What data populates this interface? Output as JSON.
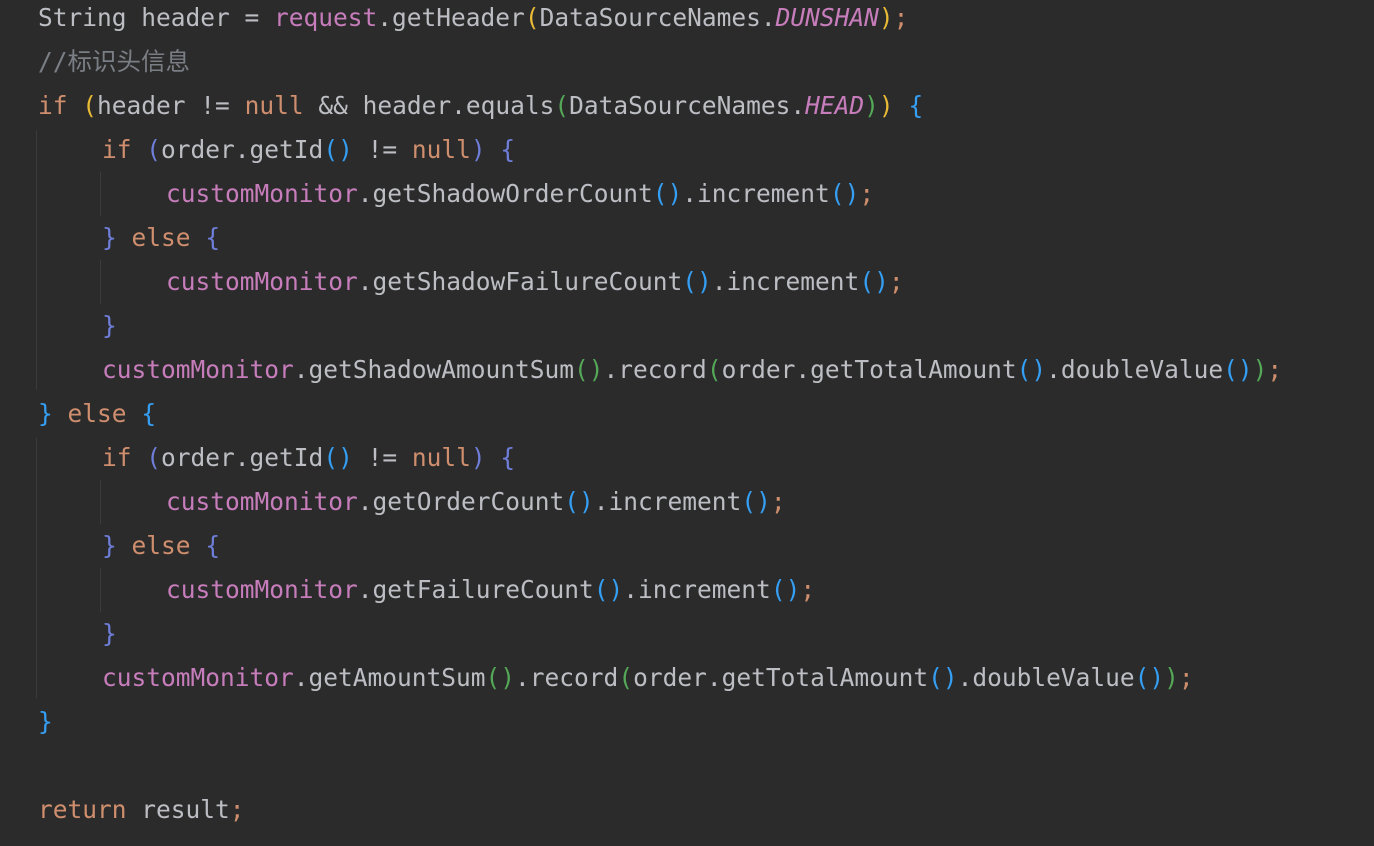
{
  "lines": [
    {
      "indent": 0,
      "tokens": [
        {
          "t": "String",
          "c": "t-class"
        },
        {
          "t": " header = ",
          "c": "t-plain"
        },
        {
          "t": "request",
          "c": "t-field"
        },
        {
          "t": ".getHeader",
          "c": "t-method"
        },
        {
          "t": "(",
          "c": "p1"
        },
        {
          "t": "DataSourceNames.",
          "c": "t-plain"
        },
        {
          "t": "DUNSHAN",
          "c": "t-static"
        },
        {
          "t": ")",
          "c": "p1"
        },
        {
          "t": ";",
          "c": "semi"
        }
      ]
    },
    {
      "indent": 0,
      "tokens": [
        {
          "t": "//标识头信息",
          "c": "t-comment"
        }
      ]
    },
    {
      "indent": 0,
      "tokens": [
        {
          "t": "if",
          "c": "t-kw"
        },
        {
          "t": " ",
          "c": "t-plain"
        },
        {
          "t": "(",
          "c": "p1"
        },
        {
          "t": "header != ",
          "c": "t-plain"
        },
        {
          "t": "null",
          "c": "t-kw"
        },
        {
          "t": " && header.equals",
          "c": "t-plain"
        },
        {
          "t": "(",
          "c": "p2"
        },
        {
          "t": "DataSourceNames.",
          "c": "t-plain"
        },
        {
          "t": "HEAD",
          "c": "t-static"
        },
        {
          "t": ")",
          "c": "p2"
        },
        {
          "t": ")",
          "c": "p1"
        },
        {
          "t": " ",
          "c": "t-plain"
        },
        {
          "t": "{",
          "c": "p3"
        }
      ]
    },
    {
      "indent": 1,
      "tokens": [
        {
          "t": "if",
          "c": "t-kw"
        },
        {
          "t": " ",
          "c": "t-plain"
        },
        {
          "t": "(",
          "c": "p4"
        },
        {
          "t": "order.getId",
          "c": "t-plain"
        },
        {
          "t": "()",
          "c": "p3"
        },
        {
          "t": " != ",
          "c": "t-plain"
        },
        {
          "t": "null",
          "c": "t-kw"
        },
        {
          "t": ")",
          "c": "p4"
        },
        {
          "t": " ",
          "c": "t-plain"
        },
        {
          "t": "{",
          "c": "p4"
        }
      ]
    },
    {
      "indent": 2,
      "tokens": [
        {
          "t": "customMonitor",
          "c": "t-field"
        },
        {
          "t": ".getShadowOrderCount",
          "c": "t-plain"
        },
        {
          "t": "()",
          "c": "p3"
        },
        {
          "t": ".increment",
          "c": "t-plain"
        },
        {
          "t": "()",
          "c": "p3"
        },
        {
          "t": ";",
          "c": "semi"
        }
      ]
    },
    {
      "indent": 1,
      "tokens": [
        {
          "t": "}",
          "c": "p4"
        },
        {
          "t": " ",
          "c": "t-plain"
        },
        {
          "t": "else",
          "c": "t-kw"
        },
        {
          "t": " ",
          "c": "t-plain"
        },
        {
          "t": "{",
          "c": "p4"
        }
      ]
    },
    {
      "indent": 2,
      "tokens": [
        {
          "t": "customMonitor",
          "c": "t-field"
        },
        {
          "t": ".getShadowFailureCount",
          "c": "t-plain"
        },
        {
          "t": "()",
          "c": "p3"
        },
        {
          "t": ".increment",
          "c": "t-plain"
        },
        {
          "t": "()",
          "c": "p3"
        },
        {
          "t": ";",
          "c": "semi"
        }
      ]
    },
    {
      "indent": 1,
      "tokens": [
        {
          "t": "}",
          "c": "p4"
        }
      ]
    },
    {
      "indent": 1,
      "tokens": [
        {
          "t": "customMonitor",
          "c": "t-field"
        },
        {
          "t": ".getShadowAmountSum",
          "c": "t-plain"
        },
        {
          "t": "()",
          "c": "p2"
        },
        {
          "t": ".record",
          "c": "t-plain"
        },
        {
          "t": "(",
          "c": "p2"
        },
        {
          "t": "order.getTotalAmount",
          "c": "t-plain"
        },
        {
          "t": "()",
          "c": "p3"
        },
        {
          "t": ".doubleValue",
          "c": "t-plain"
        },
        {
          "t": "()",
          "c": "p3"
        },
        {
          "t": ")",
          "c": "p2"
        },
        {
          "t": ";",
          "c": "semi"
        }
      ]
    },
    {
      "indent": 0,
      "tokens": [
        {
          "t": "}",
          "c": "p3"
        },
        {
          "t": " ",
          "c": "t-plain"
        },
        {
          "t": "else",
          "c": "t-kw"
        },
        {
          "t": " ",
          "c": "t-plain"
        },
        {
          "t": "{",
          "c": "p3"
        }
      ]
    },
    {
      "indent": 1,
      "tokens": [
        {
          "t": "if",
          "c": "t-kw"
        },
        {
          "t": " ",
          "c": "t-plain"
        },
        {
          "t": "(",
          "c": "p4"
        },
        {
          "t": "order.getId",
          "c": "t-plain"
        },
        {
          "t": "()",
          "c": "p3"
        },
        {
          "t": " != ",
          "c": "t-plain"
        },
        {
          "t": "null",
          "c": "t-kw"
        },
        {
          "t": ")",
          "c": "p4"
        },
        {
          "t": " ",
          "c": "t-plain"
        },
        {
          "t": "{",
          "c": "p4"
        }
      ]
    },
    {
      "indent": 2,
      "tokens": [
        {
          "t": "customMonitor",
          "c": "t-field"
        },
        {
          "t": ".getOrderCount",
          "c": "t-plain"
        },
        {
          "t": "()",
          "c": "p3"
        },
        {
          "t": ".increment",
          "c": "t-plain"
        },
        {
          "t": "()",
          "c": "p3"
        },
        {
          "t": ";",
          "c": "semi"
        }
      ]
    },
    {
      "indent": 1,
      "tokens": [
        {
          "t": "}",
          "c": "p4"
        },
        {
          "t": " ",
          "c": "t-plain"
        },
        {
          "t": "else",
          "c": "t-kw"
        },
        {
          "t": " ",
          "c": "t-plain"
        },
        {
          "t": "{",
          "c": "p4"
        }
      ]
    },
    {
      "indent": 2,
      "tokens": [
        {
          "t": "customMonitor",
          "c": "t-field"
        },
        {
          "t": ".getFailureCount",
          "c": "t-plain"
        },
        {
          "t": "()",
          "c": "p3"
        },
        {
          "t": ".increment",
          "c": "t-plain"
        },
        {
          "t": "()",
          "c": "p3"
        },
        {
          "t": ";",
          "c": "semi"
        }
      ]
    },
    {
      "indent": 1,
      "tokens": [
        {
          "t": "}",
          "c": "p4"
        }
      ]
    },
    {
      "indent": 1,
      "tokens": [
        {
          "t": "customMonitor",
          "c": "t-field"
        },
        {
          "t": ".getAmountSum",
          "c": "t-plain"
        },
        {
          "t": "()",
          "c": "p2"
        },
        {
          "t": ".record",
          "c": "t-plain"
        },
        {
          "t": "(",
          "c": "p2"
        },
        {
          "t": "order.getTotalAmount",
          "c": "t-plain"
        },
        {
          "t": "()",
          "c": "p3"
        },
        {
          "t": ".doubleValue",
          "c": "t-plain"
        },
        {
          "t": "()",
          "c": "p3"
        },
        {
          "t": ")",
          "c": "p2"
        },
        {
          "t": ";",
          "c": "semi"
        }
      ]
    },
    {
      "indent": 0,
      "tokens": [
        {
          "t": "}",
          "c": "p3"
        }
      ]
    },
    {
      "indent": 0,
      "tokens": []
    },
    {
      "indent": 0,
      "tokens": [
        {
          "t": "return",
          "c": "t-kw"
        },
        {
          "t": " result",
          "c": "t-plain"
        },
        {
          "t": ";",
          "c": "semi"
        }
      ]
    }
  ],
  "theme": {
    "background": "#2b2b2b",
    "keyword": "#cf8e6d",
    "field": "#c77dbb",
    "comment": "#7a7e85",
    "plain": "#bcbec4",
    "bracket_1": "#e8ba36",
    "bracket_2": "#54a857",
    "bracket_3": "#359ff4",
    "bracket_4": "#6e7ed9"
  }
}
